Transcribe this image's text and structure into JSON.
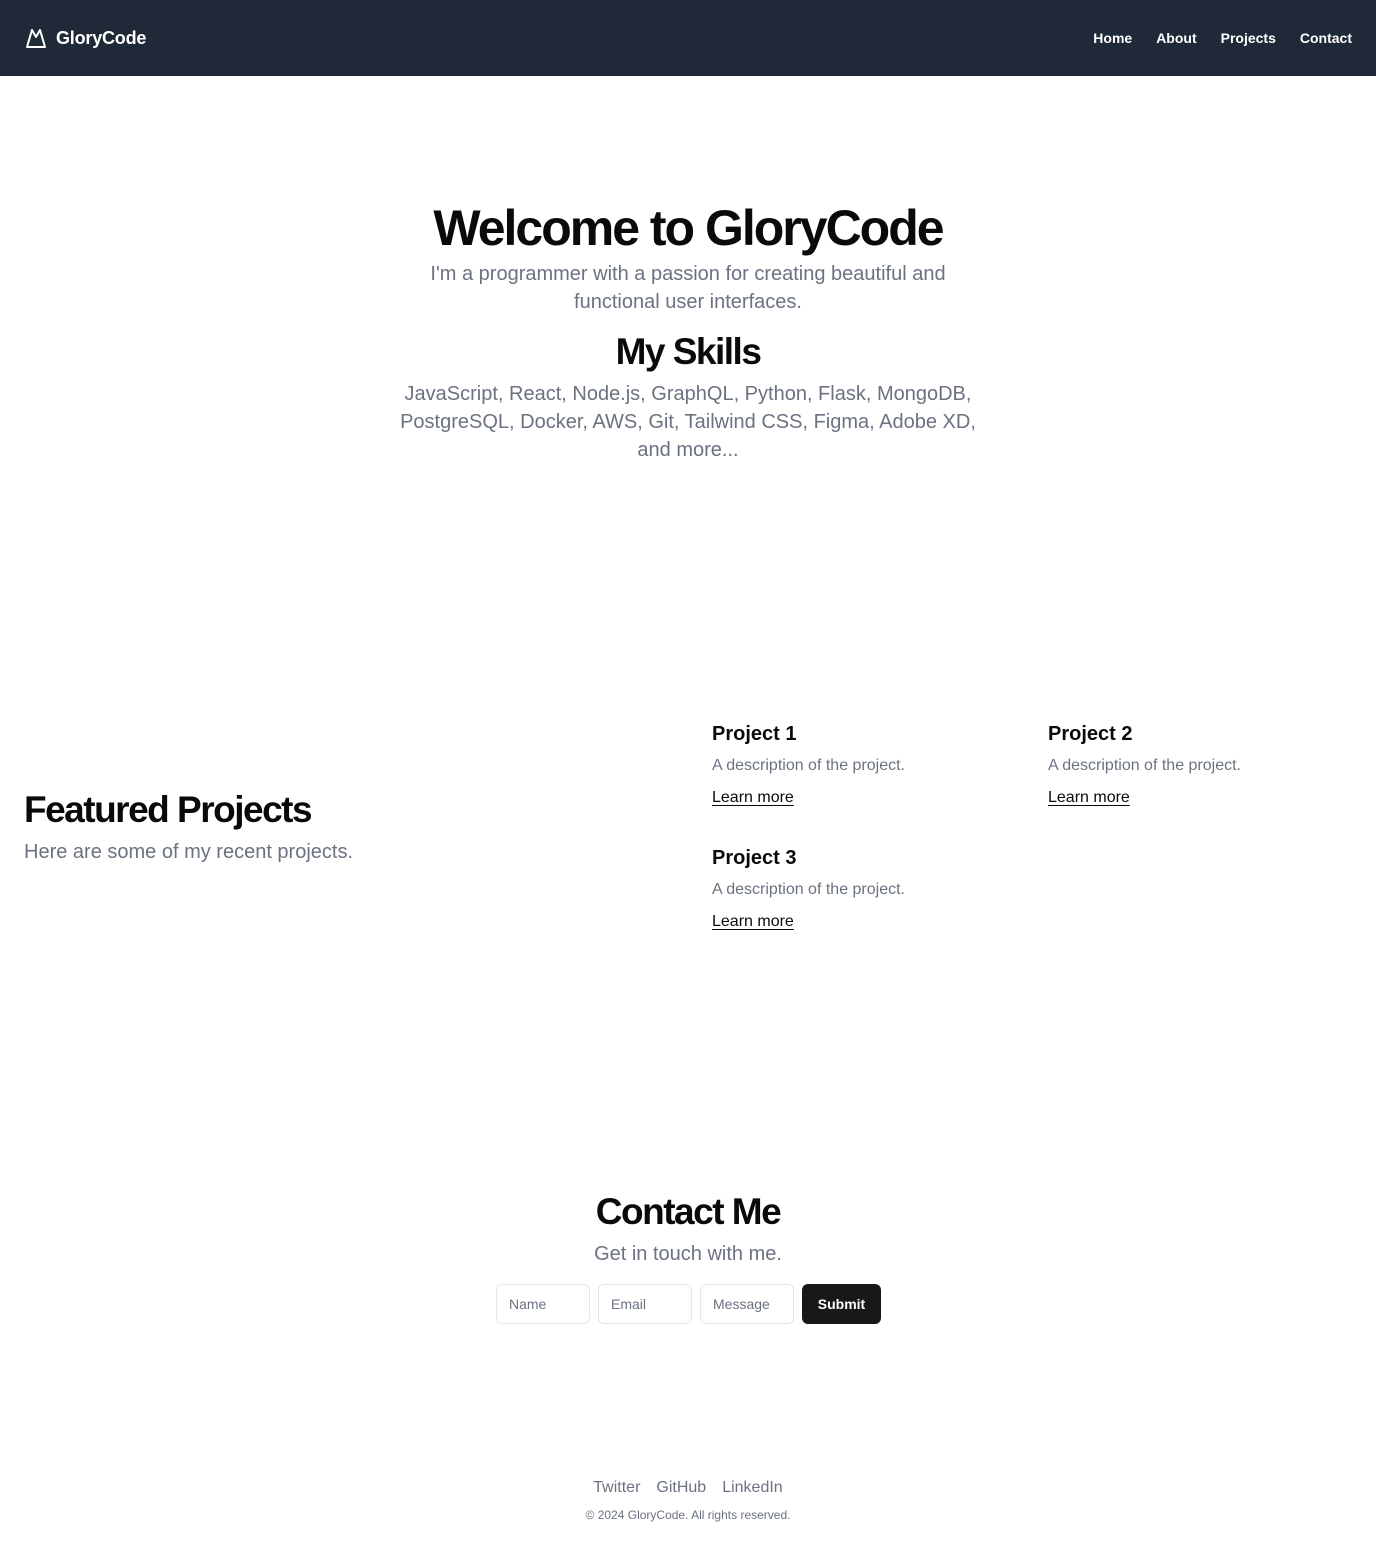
{
  "nav": {
    "brand": "GloryCode",
    "brand_icon": "mountain-icon",
    "links": [
      "Home",
      "About",
      "Projects",
      "Contact"
    ]
  },
  "hero": {
    "title": "Welcome to GloryCode",
    "subtitle": "I'm a programmer with a passion for creating beautiful and functional user interfaces.",
    "skills_title": "My Skills",
    "skills_text": "JavaScript, React, Node.js, GraphQL, Python, Flask, MongoDB, PostgreSQL, Docker, AWS, Git, Tailwind CSS, Figma, Adobe XD, and more..."
  },
  "featured": {
    "title": "Featured Projects",
    "subtitle": "Here are some of my recent projects.",
    "projects": [
      {
        "title": "Project 1",
        "description": "A description of the project.",
        "link": "Learn more"
      },
      {
        "title": "Project 2",
        "description": "A description of the project.",
        "link": "Learn more"
      },
      {
        "title": "Project 3",
        "description": "A description of the project.",
        "link": "Learn more"
      }
    ]
  },
  "contact": {
    "title": "Contact Me",
    "subtitle": "Get in touch with me.",
    "name_placeholder": "Name",
    "email_placeholder": "Email",
    "message_placeholder": "Message",
    "submit_label": "Submit"
  },
  "footer": {
    "links": [
      "Twitter",
      "GitHub",
      "LinkedIn"
    ],
    "copyright": "© 2024 GloryCode. All rights reserved."
  },
  "colors": {
    "navbar_bg": "#1f2937",
    "muted_text": "#6b7280",
    "button_bg": "#18181b"
  }
}
